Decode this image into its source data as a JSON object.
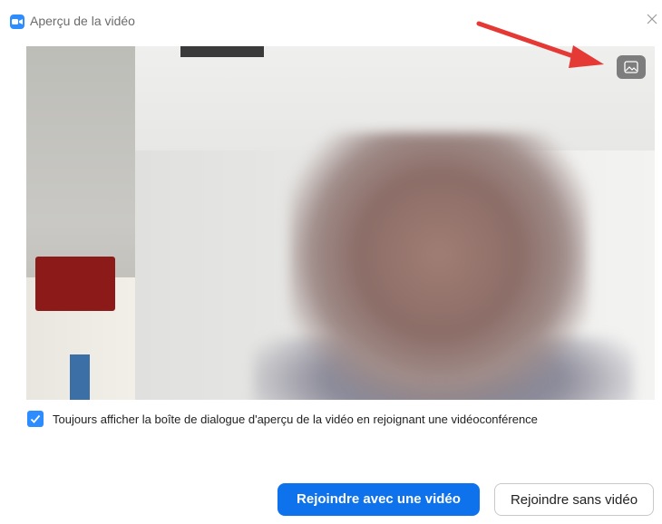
{
  "window": {
    "title": "Aperçu de la vidéo"
  },
  "preview": {
    "background_toggle_icon": "image-icon"
  },
  "options": {
    "always_show_preview_label": "Toujours afficher la boîte de dialogue d'aperçu de la vidéo en rejoignant une vidéoconférence",
    "always_show_preview_checked": true
  },
  "actions": {
    "join_with_video": "Rejoindre avec une vidéo",
    "join_without_video": "Rejoindre sans vidéo"
  },
  "colors": {
    "accent": "#2D8CFF",
    "primary_button": "#0E72ED",
    "annotation_arrow": "#E53935"
  }
}
